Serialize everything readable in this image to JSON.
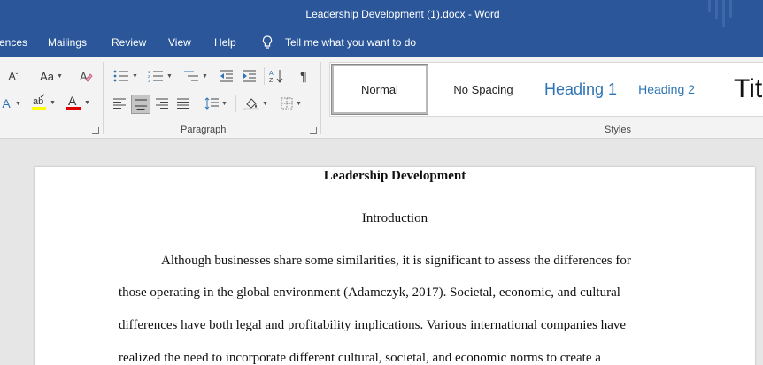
{
  "titlebar": {
    "title": "Leadership Development (1).docx  -  Word"
  },
  "menu": {
    "tabs": [
      "ences",
      "Mailings",
      "Review",
      "View",
      "Help"
    ],
    "tell_me": "Tell me what you want to do"
  },
  "ribbon": {
    "font_case_label": "Aa",
    "paragraph_group_label": "Paragraph",
    "styles_group_label": "Styles",
    "styles": [
      "Normal",
      "No Spacing",
      "Heading 1",
      "Heading 2",
      "Tit"
    ],
    "colors": {
      "highlight": "#ffff00",
      "font_color": "#e00000",
      "heading": "#2e74b5",
      "title_bar": "#2b579a"
    }
  },
  "document": {
    "title": "Leadership Development",
    "heading": "Introduction",
    "lines": [
      "Although businesses share some similarities, it is significant to assess the differences for",
      "those operating in the global environment (Adamczyk, 2017). Societal, economic, and cultural",
      "differences have both legal and profitability implications. Various international companies have",
      "realized the need to incorporate different cultural, societal, and economic norms to create a"
    ]
  }
}
